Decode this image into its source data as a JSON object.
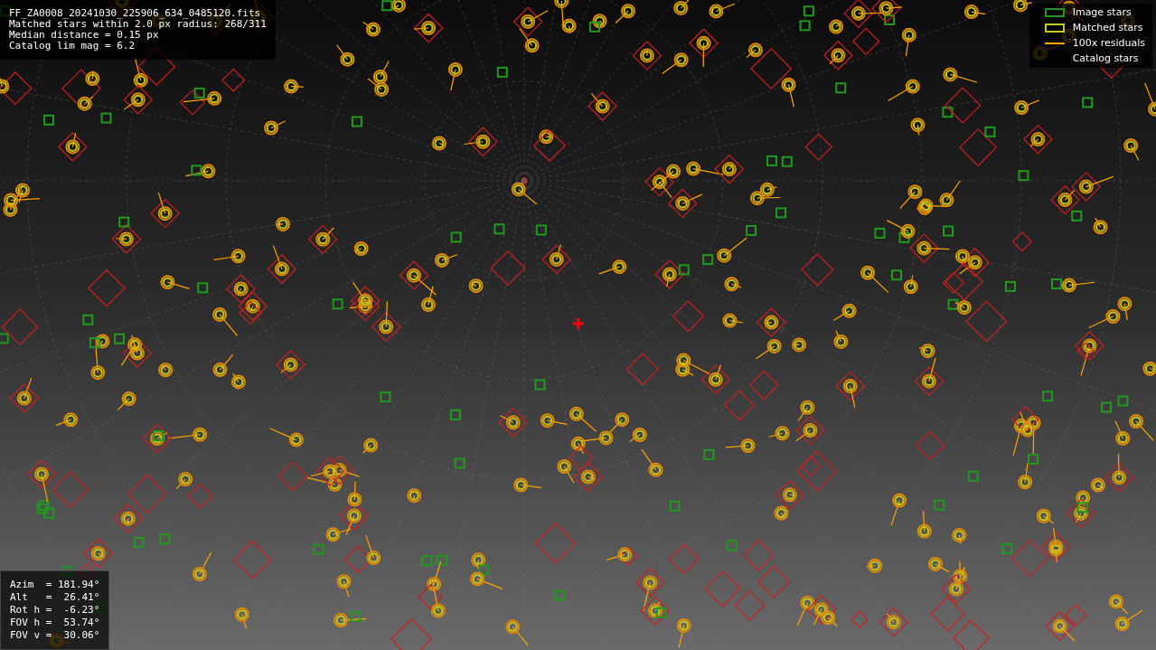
{
  "image_info": {
    "lines": [
      "FF_ZA0008_20241030_225906_634_0485120.fits",
      "Matched stars within 2.0 px radius: 268/311",
      "Median distance = 0.15 px",
      "Catalog lim mag = 6.2"
    ]
  },
  "legend": [
    {
      "label": "Image stars",
      "kind": "box",
      "color": "#1f9a1f"
    },
    {
      "label": "Matched stars",
      "kind": "box",
      "color": "#c8c81e"
    },
    {
      "label": "100x residuals",
      "kind": "line",
      "color": "#ffa500"
    },
    {
      "label": "Catalog stars",
      "kind": "none"
    }
  ],
  "pointing_info": {
    "lines": [
      "Azim  = 181.94°",
      "Alt   =  26.41°",
      "Rot h =  -6.23°",
      "FOV h =  53.74°",
      "FOV v =  30.06°"
    ]
  }
}
